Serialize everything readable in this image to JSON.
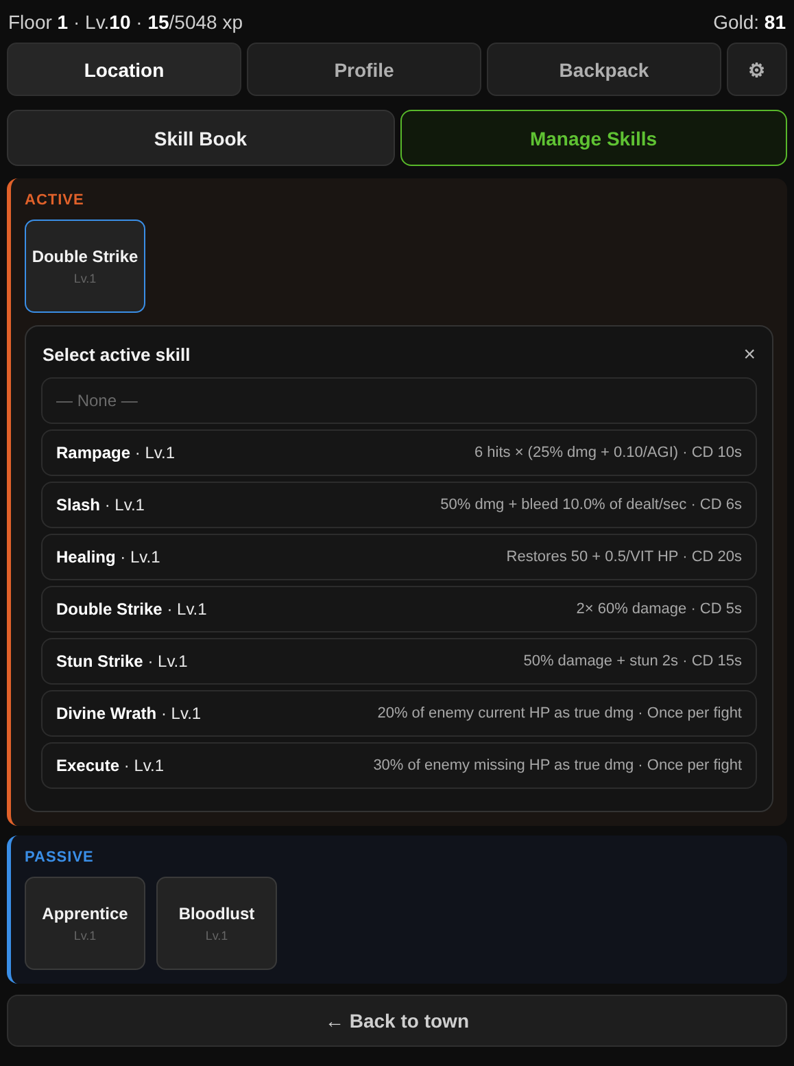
{
  "header": {
    "progress": "Floor **1** · Lv.**10** · **15**/5048 xp",
    "gold": "Gold: **81**"
  },
  "tabs": [
    {
      "label": "Location",
      "selected": true
    },
    {
      "label": "Profile",
      "selected": false
    },
    {
      "label": "Backpack",
      "selected": false
    },
    {
      "label": "⚙",
      "selected": false,
      "kind": "icon"
    }
  ],
  "modes": [
    {
      "label": "Skill Book",
      "selected": false
    },
    {
      "label": "Manage Skills",
      "selected": true
    }
  ],
  "active": {
    "title": "ACTIVE",
    "color": "#e0612a",
    "slots": [
      {
        "name": "Double Strike",
        "level": "Lv.1",
        "selected": true
      }
    ],
    "picker": {
      "title": "Select active skill",
      "close": "×",
      "none": "— None —",
      "options": [
        {
          "name": "**Rampage** · Lv.1",
          "effect": "6 hits × (25% dmg + 0.10/AGI) · CD 10s"
        },
        {
          "name": "**Slash** · Lv.1",
          "effect": "50% dmg + bleed 10.0% of dealt/sec · CD 6s"
        },
        {
          "name": "**Healing** · Lv.1",
          "effect": "Restores 50 + 0.5/VIT HP · CD 20s"
        },
        {
          "name": "**Double Strike** · Lv.1",
          "effect": "2× 60% damage · CD 5s"
        },
        {
          "name": "**Stun Strike** · Lv.1",
          "effect": "50% damage + stun 2s · CD 15s"
        },
        {
          "name": "**Divine Wrath** · Lv.1",
          "effect": "20% of enemy current HP as true dmg · Once per fight"
        },
        {
          "name": "**Execute** · Lv.1",
          "effect": "30% of enemy missing HP as true dmg · Once per fight"
        }
      ]
    }
  },
  "passive": {
    "title": "PASSIVE",
    "color": "#3a8ee6",
    "slots": [
      {
        "name": "Apprentice",
        "level": "Lv.1",
        "selected": false
      },
      {
        "name": "Bloodlust",
        "level": "Lv.1",
        "selected": false
      }
    ]
  },
  "back": "← Back to town"
}
